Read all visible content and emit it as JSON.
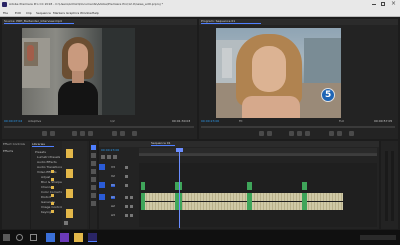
{
  "app": {
    "title": "Adobe Premiere Pro CC 2018 - C:\\Users\\Admin\\Documents\\Adobe\\Premiere Pro\\12.0\\news_edit.prproj *",
    "menu": [
      "File",
      "Edit",
      "Clip",
      "Sequence",
      "Markers",
      "Graphics",
      "Window",
      "Help"
    ]
  },
  "source_panel": {
    "tab": "Source: PRH_Bartender_Interview.mp4",
    "timecode_in": "00:00:07:04",
    "fit": "Adaptive",
    "zoom": "1/2",
    "timecode_dur": "00:01:30:03"
  },
  "program_panel": {
    "tab": "Program: Sequence 01",
    "timecode_in": "00:00:23:00",
    "fit": "Fit",
    "zoom": "Full",
    "timecode_dur": "00:00:57:05",
    "channel_logo": "5"
  },
  "project_panel": {
    "tabs": [
      "Effect Controls",
      "Libraries"
    ],
    "root_label": "Effects",
    "items": [
      "Presets",
      "Lumetri Presets",
      "Audio Effects",
      "Audio Transitions",
      "Video Effects",
      "Adjust",
      "Blur & Sharpen",
      "Channel",
      "Color Correction",
      "Distort",
      "Generate",
      "Image Control",
      "Keying"
    ]
  },
  "media_panel": {
    "tab": "Project: news_edit",
    "thumbs": 4
  },
  "timeline": {
    "tabs": [
      "Sequence 01"
    ],
    "timecode": "00:00:23:00",
    "tracks": [
      "V3",
      "V2",
      "V1",
      "A1",
      "A2",
      "A3"
    ]
  },
  "colors": {
    "accent": "#4f7fff",
    "timecode": "#2c9cf2",
    "playhead": "#6b8dff",
    "clip_audio": "#cfc9a6",
    "clip_video_green": "#3fa55a",
    "panel": "#232323",
    "bg": "#1c1c1c"
  }
}
